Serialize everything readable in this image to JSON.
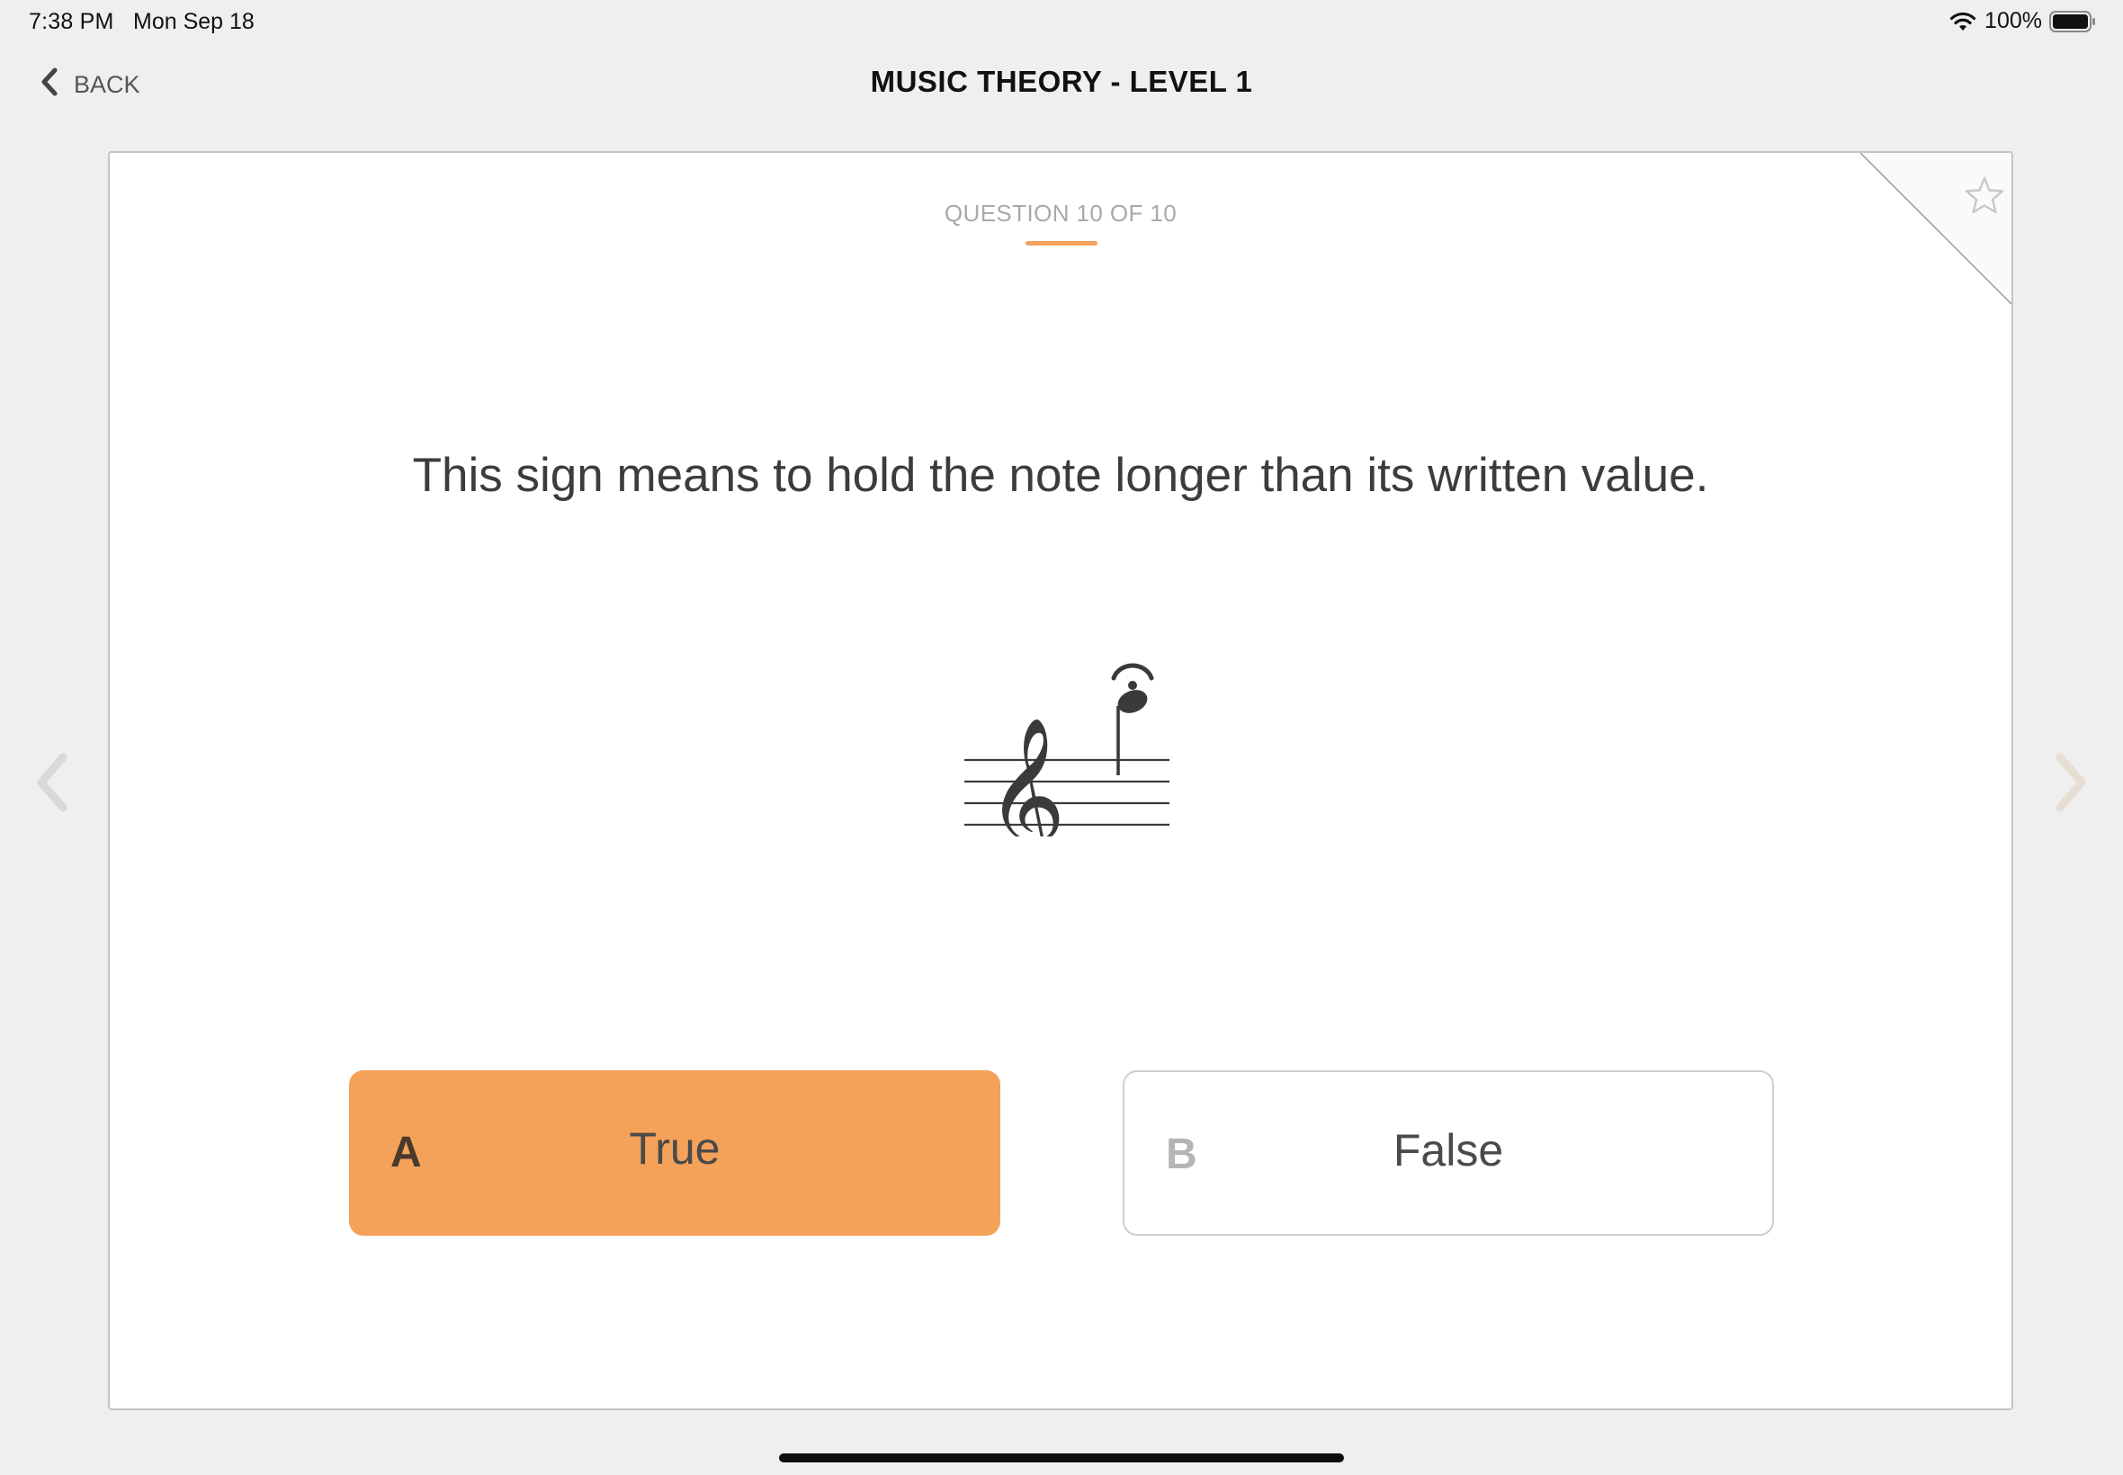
{
  "status_bar": {
    "time": "7:38 PM",
    "date": "Mon Sep 18",
    "battery": "100%"
  },
  "nav": {
    "back_label": "BACK",
    "title": "MUSIC THEORY - LEVEL 1"
  },
  "quiz": {
    "counter": "QUESTION 10 OF 10",
    "question": "This sign means to hold the note longer than its written value.",
    "answers": [
      {
        "letter": "A",
        "text": "True",
        "selected": true
      },
      {
        "letter": "B",
        "text": "False",
        "selected": false
      }
    ]
  },
  "colors": {
    "accent": "#f4a25a",
    "background": "#efefef",
    "card": "#ffffff"
  },
  "icons": {
    "back": "chevron-left-icon",
    "prev": "chevron-left-icon",
    "next": "chevron-right-icon",
    "bookmark": "star-outline-icon",
    "wifi": "wifi-icon",
    "battery": "battery-icon"
  }
}
